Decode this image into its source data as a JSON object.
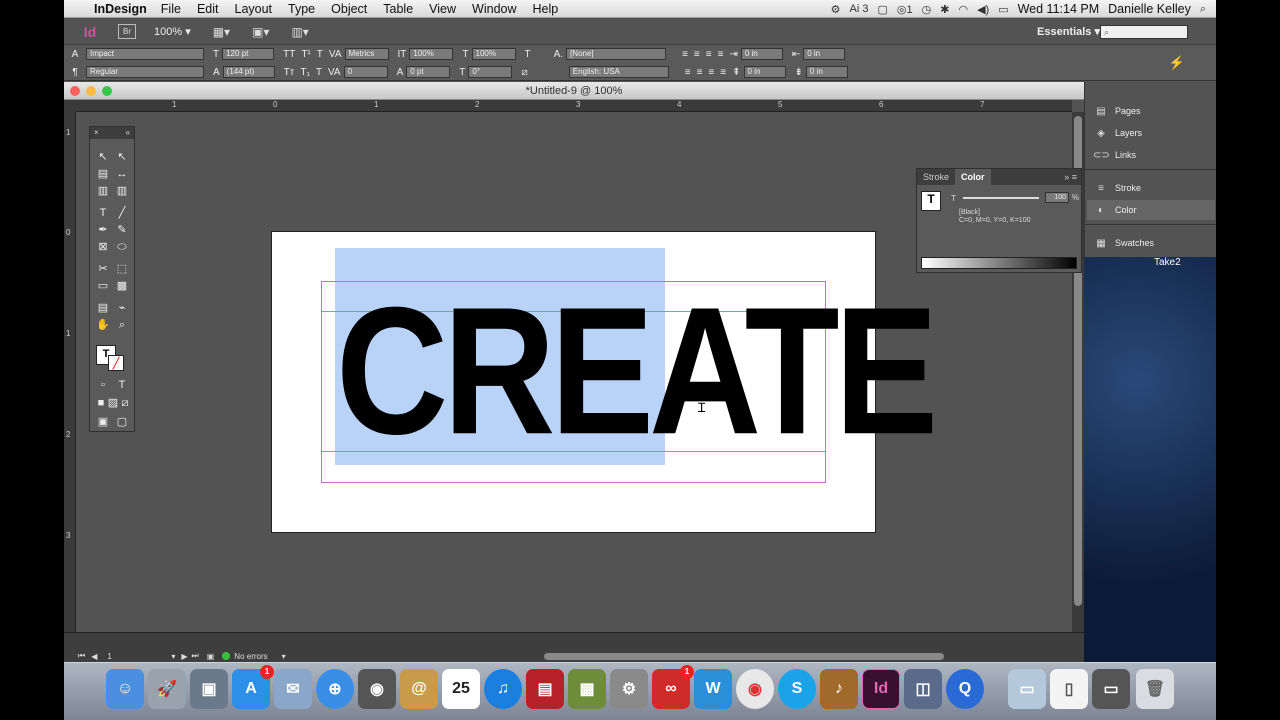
{
  "menubar": {
    "app_name": "InDesign",
    "menus": [
      "File",
      "Edit",
      "Layout",
      "Type",
      "Object",
      "Table",
      "View",
      "Window",
      "Help"
    ],
    "status_right": {
      "ai_badge": "3",
      "cc_badge": "1",
      "clock": "Wed 11:14 PM",
      "user": "Danielle Kelley"
    }
  },
  "appbar": {
    "logo": "Id",
    "bridge": "Br",
    "zoom": "100%",
    "workspace": "Essentials",
    "search_placeholder": ""
  },
  "control": {
    "font_family": "Impact",
    "font_style": "Regular",
    "font_size": "120 pt",
    "leading": "(144 pt)",
    "kerning": "Metrics",
    "tracking": "0",
    "vertical_scale": "100%",
    "horizontal_scale": "100%",
    "baseline_shift": "0 pt",
    "skew": "0°",
    "char_style": "[None]",
    "language": "English: USA",
    "indent_left": "0 in",
    "indent_right": "0 in",
    "space_before": "0 in",
    "space_after": "0 in"
  },
  "document": {
    "title": "*Untitled-9 @ 100%",
    "text": "CREATE",
    "page_number": "1",
    "preflight": "No errors",
    "ruler_h": [
      "1",
      "0",
      "1",
      "2",
      "3",
      "4",
      "5",
      "6",
      "7"
    ],
    "ruler_v": [
      "1",
      "0",
      "1",
      "2",
      "3"
    ]
  },
  "color_panel": {
    "tabs": [
      "Stroke",
      "Color"
    ],
    "active_tab": "Color",
    "tint_label": "T",
    "tint_value": "100",
    "tint_unit": "%",
    "swatch_name": "[Black]",
    "cmyk": "C=0, M=0, Y=0, K=100"
  },
  "dock_panels": [
    {
      "label": "Pages",
      "icon": "pages-icon"
    },
    {
      "label": "Layers",
      "icon": "layers-icon"
    },
    {
      "label": "Links",
      "icon": "links-icon"
    },
    {
      "label": "Stroke",
      "icon": "stroke-icon"
    },
    {
      "label": "Color",
      "icon": "color-icon"
    },
    {
      "label": "Swatches",
      "icon": "swatches-icon"
    }
  ],
  "desktop": {
    "folder_label": "Take2"
  },
  "os_dock": {
    "apps": [
      "Finder",
      "Launchpad",
      "Preview",
      "App Store",
      "Mail",
      "Safari",
      "FaceTime",
      "Contacts",
      "Calendar",
      "iTunes",
      "Photo Booth",
      "iPhoto",
      "System Preferences",
      "Creative Cloud",
      "Word",
      "Chrome",
      "Skype",
      "GarageBand",
      "InDesign",
      "Image Capture",
      "QuickTime",
      "Downloads",
      "Document",
      "Trash"
    ],
    "calendar_date": "25",
    "appstore_badge": "1",
    "cc_badge": "1"
  },
  "colors": {
    "selection": "#b8d3f7",
    "margin_guide": "#c86ec8",
    "indesign_brand": "#c35aa0"
  }
}
